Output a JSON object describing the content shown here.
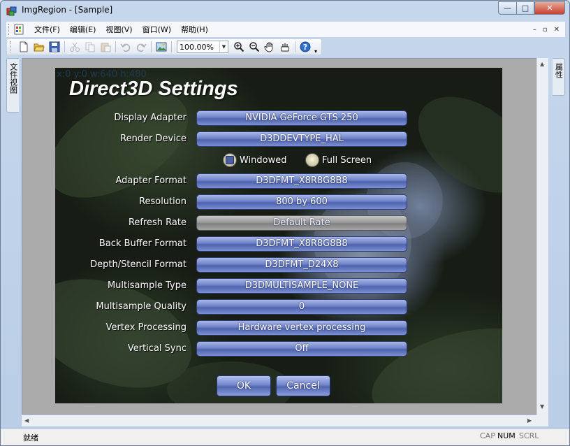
{
  "window": {
    "title": "ImgRegion - [Sample]",
    "controls": {
      "minimize": "—",
      "maximize": "□",
      "close": "✕"
    }
  },
  "menu": {
    "items": [
      "文件(F)",
      "编辑(E)",
      "视图(V)",
      "窗口(W)",
      "帮助(H)"
    ],
    "mdi_controls": {
      "minimize": "–",
      "restore": "▫",
      "close": "✕"
    }
  },
  "toolbar": {
    "zoom_value": "100.00%"
  },
  "side_tabs": {
    "left": "文件视图",
    "right": "属性"
  },
  "canvas": {
    "coord_readout": "x:0 y:0 w:640 h:480",
    "title": "Direct3D Settings",
    "settings": [
      {
        "label": "Display Adapter",
        "value": "NVIDIA GeForce GTS 250",
        "enabled": true
      },
      {
        "label": "Render Device",
        "value": "D3DDEVTYPE_HAL",
        "enabled": true
      },
      {
        "label": "Adapter Format",
        "value": "D3DFMT_X8R8G8B8",
        "enabled": true
      },
      {
        "label": "Resolution",
        "value": "800 by 600",
        "enabled": true
      },
      {
        "label": "Refresh Rate",
        "value": "Default Rate",
        "enabled": false
      },
      {
        "label": "Back Buffer Format",
        "value": "D3DFMT_X8R8G8B8",
        "enabled": true
      },
      {
        "label": "Depth/Stencil Format",
        "value": "D3DFMT_D24X8",
        "enabled": true
      },
      {
        "label": "Multisample Type",
        "value": "D3DMULTISAMPLE_NONE",
        "enabled": true
      },
      {
        "label": "Multisample Quality",
        "value": "0",
        "enabled": true
      },
      {
        "label": "Vertex Processing",
        "value": "Hardware vertex processing",
        "enabled": true
      },
      {
        "label": "Vertical Sync",
        "value": "Off",
        "enabled": true
      }
    ],
    "display_mode": {
      "windowed_label": "Windowed",
      "fullscreen_label": "Full Screen",
      "selected": "Windowed"
    },
    "buttons": {
      "ok": "OK",
      "cancel": "Cancel"
    }
  },
  "statusbar": {
    "text": "就绪",
    "indicators": [
      {
        "label": "CAP",
        "active": false
      },
      {
        "label": "NUM",
        "active": true
      },
      {
        "label": "SCRL",
        "active": false
      }
    ]
  },
  "colors": {
    "combo_blue": "#6f82c8",
    "combo_disabled": "#999999",
    "client_gray": "#ababab"
  }
}
